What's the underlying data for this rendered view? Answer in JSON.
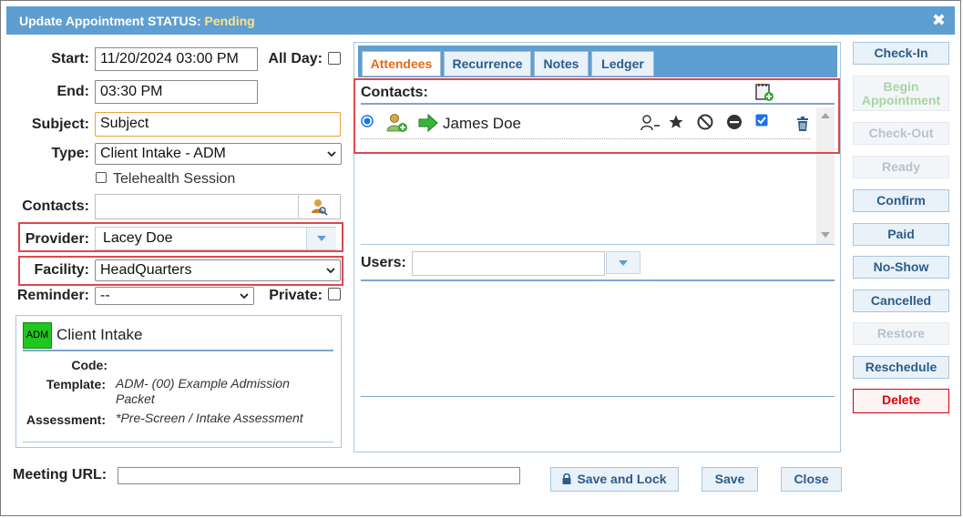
{
  "window": {
    "title": "Update Appointment STATUS:",
    "status": "Pending"
  },
  "form": {
    "start_label": "Start:",
    "start_value": "11/20/2024 03:00 PM",
    "allday_label": "All Day:",
    "end_label": "End:",
    "end_value": "03:30 PM",
    "subject_label": "Subject:",
    "subject_value": "Subject",
    "type_label": "Type:",
    "type_value": "Client Intake - ADM",
    "telehealth_label": "Telehealth Session",
    "contacts_label": "Contacts:",
    "provider_label": "Provider:",
    "provider_value": "Lacey Doe",
    "facility_label": "Facility:",
    "facility_value": "HeadQuarters",
    "reminder_label": "Reminder:",
    "reminder_value": "--",
    "private_label": "Private:",
    "meeting_url_label": "Meeting URL:",
    "meeting_url_value": ""
  },
  "type_card": {
    "badge": "ADM",
    "badge_color": "#21c61f",
    "title": "Client Intake",
    "code_label": "Code:",
    "code_value": "",
    "template_label": "Template:",
    "template_value": "ADM- (00) Example Admission Packet",
    "assessment_label": "Assessment:",
    "assessment_value": "*Pre-Screen / Intake Assessment"
  },
  "tabs": [
    {
      "label": "Attendees",
      "active": true
    },
    {
      "label": "Recurrence",
      "active": false
    },
    {
      "label": "Notes",
      "active": false
    },
    {
      "label": "Ledger",
      "active": false
    }
  ],
  "attendees": {
    "contacts_header": "Contacts:",
    "rows": [
      {
        "name": "James Doe",
        "selected": true,
        "checked": true
      }
    ],
    "users_label": "Users:",
    "users_value": ""
  },
  "actions": {
    "checkin": "Check-In",
    "begin_line1": "Begin",
    "begin_line2": "Appointment",
    "checkout": "Check-Out",
    "ready": "Ready",
    "confirm": "Confirm",
    "paid": "Paid",
    "noshow": "No-Show",
    "cancelled": "Cancelled",
    "restore": "Restore",
    "reschedule": "Reschedule",
    "delete": "Delete"
  },
  "footer": {
    "save_lock": "Save and Lock",
    "save": "Save",
    "close": "Close"
  },
  "colors": {
    "accent": "#5e9ed1",
    "highlight": "#e0474c",
    "delete": "#d8000c",
    "tab_active": "#e06c1b"
  }
}
